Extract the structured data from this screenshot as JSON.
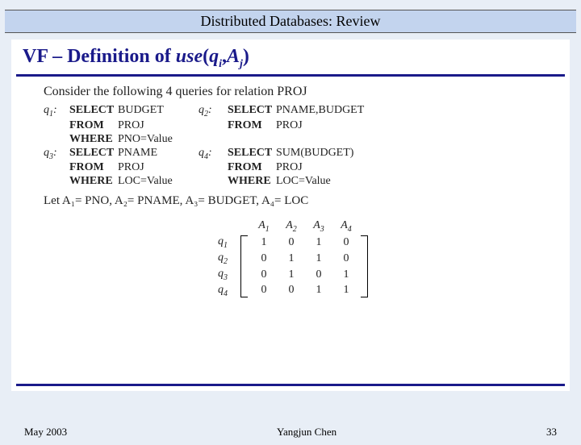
{
  "header": "Distributed Databases: Review",
  "title_prefix": "VF – Definition of ",
  "title_func": "use",
  "title_args_q": "q",
  "title_args_qi": "i",
  "title_comma": ",",
  "title_args_A": "A",
  "title_args_Aj": "j",
  "title_close": ")",
  "title_open": "(",
  "intro": "Consider the following 4 queries for relation PROJ",
  "kw": {
    "select": "SELECT",
    "from": "FROM",
    "where": "WHERE"
  },
  "q": {
    "q1": "q",
    "q1s": "1",
    "q1col": ":",
    "q2": "q",
    "q2s": "2",
    "q2col": ":",
    "q3": "q",
    "q3s": "3",
    "q3col": ":",
    "q4": "q",
    "q4s": "4",
    "q4col": ":"
  },
  "v": {
    "q1_sel": "BUDGET",
    "q1_from": "PROJ",
    "q1_where": "PNO=Value",
    "q2_sel": "PNAME,BUDGET",
    "q2_from": "PROJ",
    "q2_where": "",
    "q3_sel": "PNAME",
    "q3_from": "PROJ",
    "q3_where": "LOC=Value",
    "q4_sel": "SUM(BUDGET)",
    "q4_from": "PROJ",
    "q4_where": "LOC=Value"
  },
  "let_text": "Let A₁= PNO, A₂= PNAME, A₃= BUDGET, A₄= LOC",
  "chart_data": {
    "type": "table",
    "title": "use(q_i, A_j) matrix",
    "columns": [
      "A1",
      "A2",
      "A3",
      "A4"
    ],
    "rows": [
      "q1",
      "q2",
      "q3",
      "q4"
    ],
    "values": [
      [
        1,
        0,
        1,
        0
      ],
      [
        0,
        1,
        1,
        0
      ],
      [
        0,
        1,
        0,
        1
      ],
      [
        0,
        0,
        1,
        1
      ]
    ]
  },
  "mh": {
    "A": "A",
    "a1": "1",
    "a2": "2",
    "a3": "3",
    "a4": "4",
    "q": "q",
    "r1": "1",
    "r2": "2",
    "r3": "3",
    "r4": "4"
  },
  "footer": {
    "date": "May 2003",
    "author": "Yangjun Chen",
    "page": "33"
  }
}
